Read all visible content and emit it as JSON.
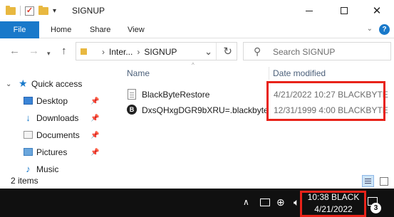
{
  "window": {
    "title": "SIGNUP",
    "controls": {
      "minimize": "—",
      "maximize": "☐",
      "close": "✕"
    }
  },
  "ribbon": {
    "tabs": [
      "File",
      "Home",
      "Share",
      "View"
    ]
  },
  "address_bar": {
    "crumbs": [
      "Inter...",
      "SIGNUP"
    ],
    "separator": "›"
  },
  "search": {
    "placeholder": "Search SIGNUP"
  },
  "nav_pane": {
    "quick_access": "Quick access",
    "items": [
      {
        "label": "Desktop",
        "icon": "desktop-icon",
        "pinned": true
      },
      {
        "label": "Downloads",
        "icon": "downloads-icon",
        "pinned": true
      },
      {
        "label": "Documents",
        "icon": "documents-icon",
        "pinned": true
      },
      {
        "label": "Pictures",
        "icon": "pictures-icon",
        "pinned": true
      },
      {
        "label": "Music",
        "icon": "music-icon",
        "pinned": false
      }
    ]
  },
  "file_list": {
    "columns": {
      "name": "Name",
      "date": "Date modified"
    },
    "files": [
      {
        "name": "BlackByteRestore",
        "date": "4/21/2022 10:27 BLACKBYTE",
        "icon": "text-document-icon"
      },
      {
        "name": "DxsQHxgDGR9bXRU=.blackbyte",
        "date": "12/31/1999 4:00 BLACKBYTE",
        "icon": "blackbyte-file-icon"
      }
    ]
  },
  "status_bar": {
    "item_count": "2 items"
  },
  "taskbar": {
    "clock_time": "10:38 BLACK",
    "clock_date": "4/21/2022",
    "notification_count": "3"
  },
  "colors": {
    "accent": "#1979ca",
    "highlight": "#e8231a",
    "taskbar": "#101010"
  }
}
